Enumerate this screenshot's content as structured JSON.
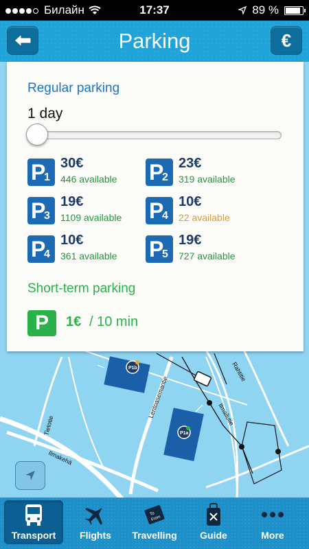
{
  "status_bar": {
    "carrier": "Билайн",
    "time": "17:37",
    "battery": "89 %",
    "battery_level": 0.89
  },
  "nav": {
    "title": "Parking",
    "currency_button": "€"
  },
  "regular": {
    "title": "Regular parking",
    "duration": "1 day",
    "slider_level": 0.0,
    "lots": [
      {
        "letter": "P",
        "number": "1",
        "price": "30€",
        "available": "446 available",
        "status": "ok"
      },
      {
        "letter": "P",
        "number": "2",
        "price": "23€",
        "available": "319 available",
        "status": "ok"
      },
      {
        "letter": "P",
        "number": "3",
        "price": "19€",
        "available": "1109 available",
        "status": "ok"
      },
      {
        "letter": "P",
        "number": "4",
        "price": "10€",
        "available": "22 available",
        "status": "low"
      },
      {
        "letter": "P",
        "number": "4",
        "price": "10€",
        "available": "361 available",
        "status": "ok"
      },
      {
        "letter": "P",
        "number": "5",
        "price": "19€",
        "available": "727 available",
        "status": "ok"
      }
    ]
  },
  "short_term": {
    "title": "Short-term parking",
    "badge": "P",
    "price": "1€",
    "period": "/ 10 min"
  },
  "map": {
    "road_labels": [
      "Tietotie",
      "Ilmakehä",
      "Lentoasemantie",
      "Ilmailutie",
      "Rahtitie"
    ],
    "marker_labels": [
      "P1b",
      "P1a"
    ]
  },
  "tabs": [
    {
      "label": "Transport",
      "icon": "bus-icon",
      "active": true
    },
    {
      "label": "Flights",
      "icon": "plane-icon",
      "active": false
    },
    {
      "label": "Travelling",
      "icon": "ticket-icon",
      "active": false
    },
    {
      "label": "Guide",
      "icon": "guide-icon",
      "active": false
    },
    {
      "label": "More",
      "icon": "more-icon",
      "active": false
    }
  ],
  "ticket_icon_text": [
    "To",
    "From"
  ],
  "colors": {
    "accent": "#1fa3d9",
    "regular_title": "#1a76c0",
    "lot_badge": "#1c6ab4",
    "available_ok": "#1f9a3a",
    "available_low": "#e19a2a",
    "short_term": "#2ab14a",
    "tab_active": "#0c5f92"
  }
}
